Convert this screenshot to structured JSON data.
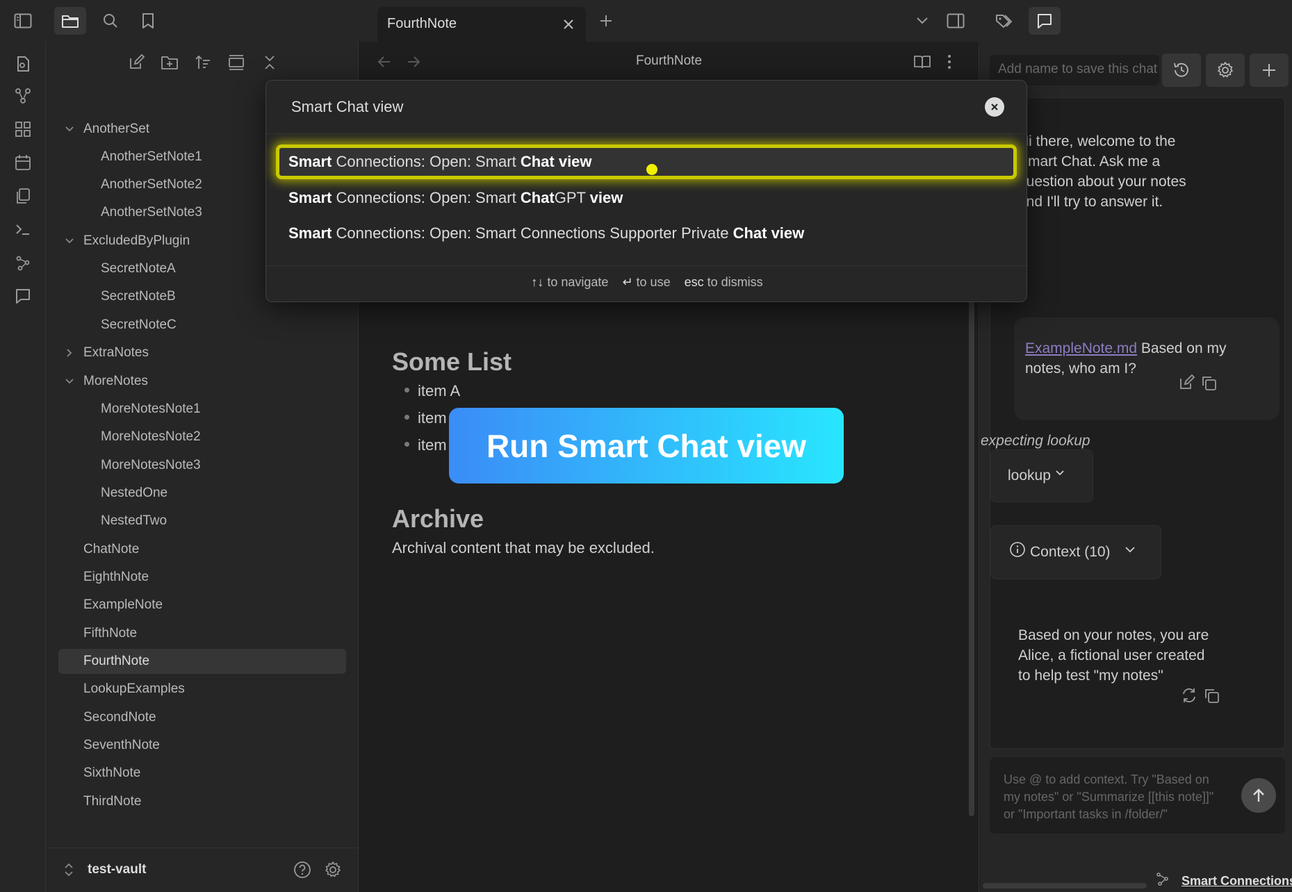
{
  "titlebar": {
    "tab_title": "FourthNote"
  },
  "explorer": {
    "tree": [
      {
        "label": "AnotherSet",
        "type": "folder",
        "expanded": true
      },
      {
        "label": "AnotherSetNote1",
        "type": "file"
      },
      {
        "label": "AnotherSetNote2",
        "type": "file"
      },
      {
        "label": "AnotherSetNote3",
        "type": "file"
      },
      {
        "label": "ExcludedByPlugin",
        "type": "folder",
        "expanded": true
      },
      {
        "label": "SecretNoteA",
        "type": "file"
      },
      {
        "label": "SecretNoteB",
        "type": "file"
      },
      {
        "label": "SecretNoteC",
        "type": "file"
      },
      {
        "label": "ExtraNotes",
        "type": "folder",
        "expanded": false
      },
      {
        "label": "MoreNotes",
        "type": "folder",
        "expanded": true
      },
      {
        "label": "MoreNotesNote1",
        "type": "file"
      },
      {
        "label": "MoreNotesNote2",
        "type": "file"
      },
      {
        "label": "MoreNotesNote3",
        "type": "file"
      },
      {
        "label": "NestedOne",
        "type": "file"
      },
      {
        "label": "NestedTwo",
        "type": "file"
      },
      {
        "label": "ChatNote",
        "type": "file"
      },
      {
        "label": "EighthNote",
        "type": "file"
      },
      {
        "label": "ExampleNote",
        "type": "file"
      },
      {
        "label": "FifthNote",
        "type": "file"
      },
      {
        "label": "FourthNote",
        "type": "file",
        "active": true
      },
      {
        "label": "LookupExamples",
        "type": "file"
      },
      {
        "label": "SecondNote",
        "type": "file"
      },
      {
        "label": "SeventhNote",
        "type": "file"
      },
      {
        "label": "SixthNote",
        "type": "file"
      },
      {
        "label": "ThirdNote",
        "type": "file"
      }
    ],
    "vault_name": "test-vault"
  },
  "editor": {
    "title": "FourthNote",
    "heading_list": "Some List",
    "items": [
      "item A",
      "item",
      "item"
    ],
    "heading_archive": "Archive",
    "archive_text": "Archival content that may be excluded."
  },
  "palette": {
    "query": "Smart Chat view",
    "results": [
      {
        "parts": [
          {
            "t": "Smart",
            "b": true
          },
          {
            "t": " Connections: Open: Smart ",
            "b": false
          },
          {
            "t": "Chat view",
            "b": true
          }
        ]
      },
      {
        "parts": [
          {
            "t": "Smart",
            "b": true
          },
          {
            "t": " Connections: Open: Smart ",
            "b": false
          },
          {
            "t": "Chat",
            "b": true
          },
          {
            "t": "GPT ",
            "b": false
          },
          {
            "t": "view",
            "b": true
          }
        ]
      },
      {
        "parts": [
          {
            "t": "Smart",
            "b": true
          },
          {
            "t": " Connections: Open: Smart Connections Supporter Private ",
            "b": false
          },
          {
            "t": "Chat view",
            "b": true
          }
        ]
      }
    ],
    "footer": {
      "navigate_key": "↑↓",
      "navigate_label": "to navigate",
      "use_key": "↵",
      "use_label": "to use",
      "dismiss_key": "esc",
      "dismiss_label": "to dismiss"
    }
  },
  "banner": {
    "text": "Run Smart Chat view"
  },
  "chat": {
    "name_placeholder": "Add name to save this chat",
    "welcome": "Hi there, welcome to the Smart Chat. Ask me a question about your notes and I'll try to answer it.",
    "user_link": "ExampleNote.md",
    "user_text": " Based on my notes, who am I?",
    "expecting": "expecting lookup",
    "lookup_label": "lookup",
    "context_label": "Context (10)",
    "answer": "Based on your notes, you are Alice, a fictional user created to help test \"my notes\"",
    "input_placeholder": "Use @ to add context. Try \"Based on my notes\" or \"Summarize [[this note]]\" or \"Important tasks in /folder/\"",
    "footer_label": "Smart Connections"
  },
  "colors": {
    "accent_highlight": "#c9c900",
    "banner_start": "#3b8cf7",
    "banner_end": "#28e6ff",
    "link": "#8e7cc3",
    "cursor": "#f0f000"
  }
}
